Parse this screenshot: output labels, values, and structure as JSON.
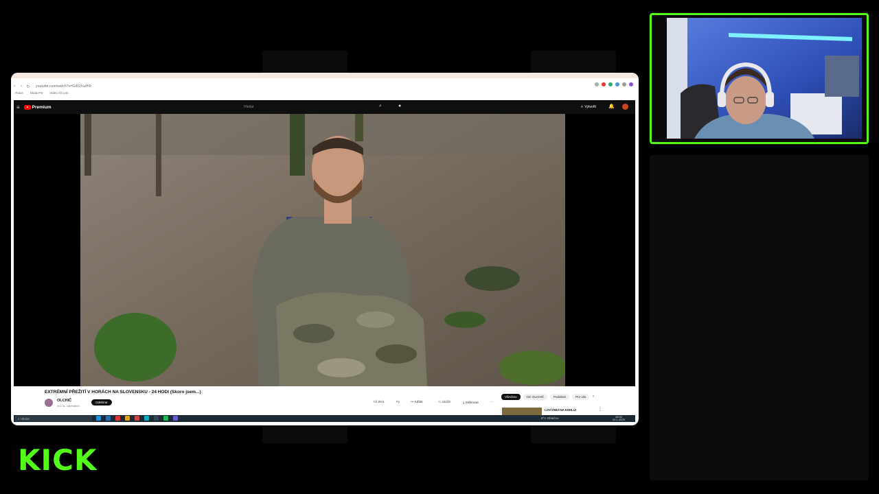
{
  "browser": {
    "url": "youtube.com/watch?v=Gd0JXwHt9",
    "bookmarks": [
      "Práce",
      "Škola PS",
      "Video All com"
    ]
  },
  "youtube": {
    "logo_text": "Premium",
    "search_placeholder": "Hledat",
    "create_label": "Vytvořit"
  },
  "video": {
    "title": "EXTRÉMNÍ PŘEŽITÍ V HORÁCH NA SLOVENSKU - 24 HODI (Skoro jsem...)",
    "channel": "OLCHIČ",
    "subscribers": "211 tis. odběratelů",
    "subscribe_label": "Odebírat",
    "likes": "20 k",
    "share_label": "Sdílet",
    "save_label": "Uložit",
    "download_label": "Stáhnout"
  },
  "chips": [
    "Všechno",
    "Od: OLCHIČ",
    "Podobné",
    "Pro vás"
  ],
  "recommended": {
    "title": "LOVÍ ZMIJÍ NA KOHLŮ!"
  },
  "taskbar": {
    "search_placeholder": "Hledat",
    "weather": "9°C  Oblačno",
    "time": "18:02",
    "date": "25.1.2025"
  },
  "overlay": {
    "logo_text": "KICK"
  },
  "colors": {
    "kick_green": "#53fc18",
    "youtube_red": "#ff0000"
  }
}
